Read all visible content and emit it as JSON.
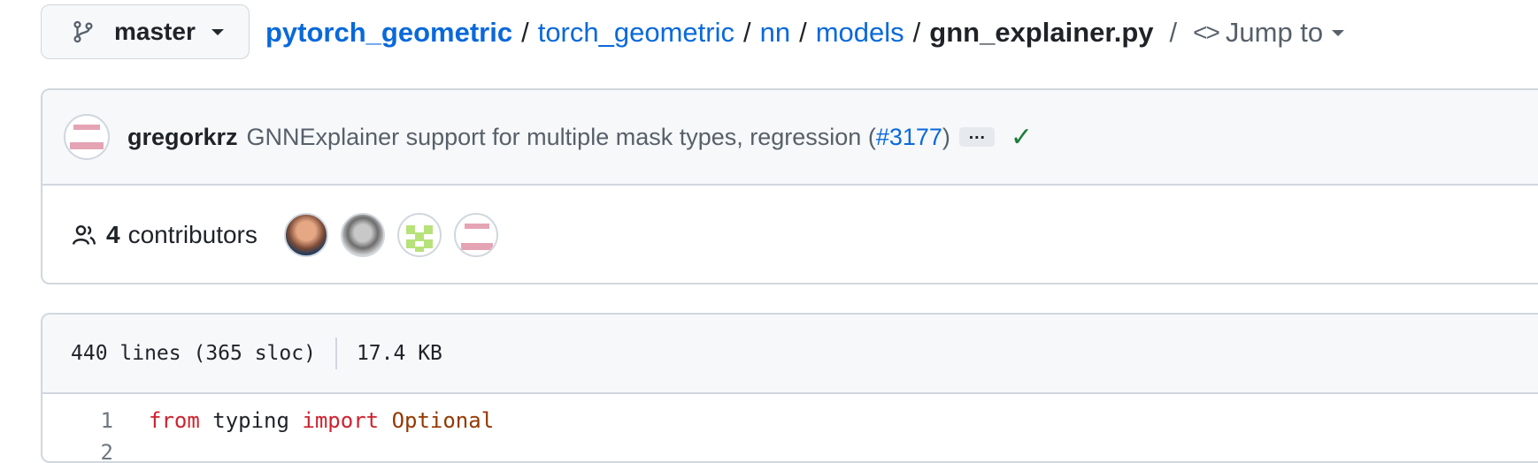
{
  "branch": {
    "name": "master"
  },
  "breadcrumb": {
    "items": [
      "pytorch_geometric",
      "torch_geometric",
      "nn",
      "models"
    ],
    "separator": "/",
    "file": "gnn_explainer.py",
    "jump_label": "Jump to"
  },
  "commit": {
    "author": "gregorkrz",
    "message_prefix": "GNNExplainer support for multiple mask types, regression (",
    "pr_link": "#3177",
    "message_suffix": ")",
    "ellipsis": "…",
    "status": "✓"
  },
  "contributors": {
    "count": "4",
    "label": "contributors"
  },
  "file_info": {
    "lines": "440 lines (365 sloc)",
    "size": "17.4 KB"
  },
  "code": {
    "line1": {
      "number": "1",
      "kw1": "from",
      "module": "typing",
      "kw2": "import",
      "name": "Optional"
    },
    "line2": {
      "number": "2"
    }
  },
  "colors": {
    "link": "#0969da",
    "keyword": "#cf222e",
    "class_name": "#953800",
    "success": "#1a7f37"
  }
}
